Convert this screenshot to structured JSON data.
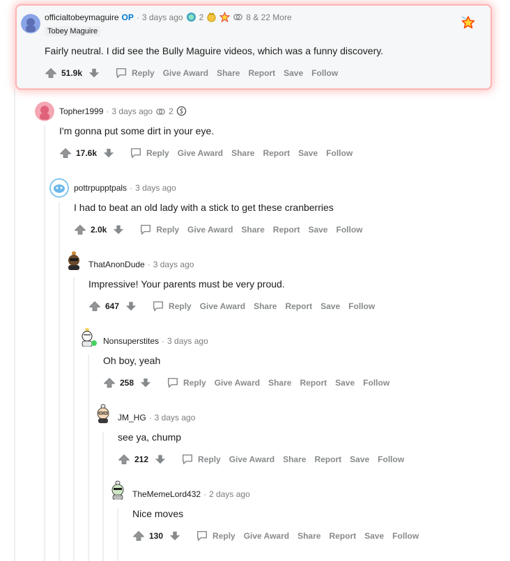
{
  "comments": [
    {
      "username": "officialtobeymaguire",
      "op_badge": "OP",
      "time": "3 days ago",
      "award_count_1": "2",
      "more_awards": "8 & 22 More",
      "flair": "Tobey Maguire",
      "text": "Fairly neutral. I did see the Bully Maguire videos, which was a funny discovery.",
      "score": "51.9k"
    },
    {
      "username": "Topher1999",
      "time": "3 days ago",
      "award_count_1": "2",
      "text": "I'm gonna put some dirt in your eye.",
      "score": "17.6k"
    },
    {
      "username": "pottrpupptpals",
      "time": "3 days ago",
      "text": "I had to beat an old lady with a stick to get these cranberries",
      "score": "2.0k"
    },
    {
      "username": "ThatAnonDude",
      "time": "3 days ago",
      "text": "Impressive! Your parents must be very proud.",
      "score": "647"
    },
    {
      "username": "Nonsuperstites",
      "time": "3 days ago",
      "text": "Oh boy, yeah",
      "score": "258"
    },
    {
      "username": "JM_HG",
      "time": "3 days ago",
      "text": "see ya, chump",
      "score": "212"
    },
    {
      "username": "TheMemeLord432",
      "time": "2 days ago",
      "text": "Nice moves",
      "score": "130"
    }
  ],
  "actions": {
    "reply": "Reply",
    "give_award": "Give Award",
    "share": "Share",
    "report": "Report",
    "save": "Save",
    "follow": "Follow"
  },
  "separator": "·",
  "colors": {
    "op": "#0079d3",
    "highlight_border": "#ff8080",
    "thread_line": "#edeff1",
    "action_gray": "#878a8c"
  }
}
